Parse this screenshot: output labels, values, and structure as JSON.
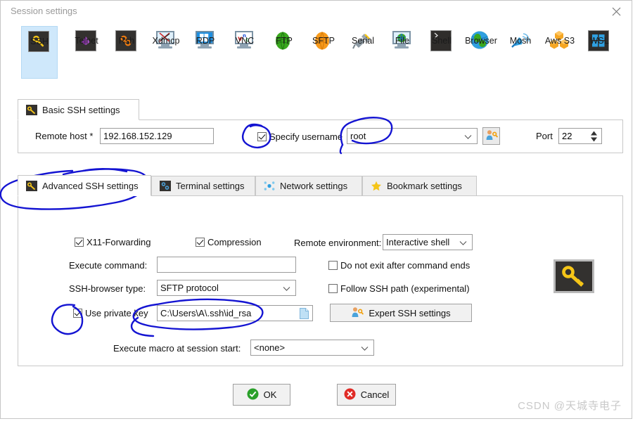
{
  "window": {
    "title": "Session settings",
    "close_icon": "close-icon"
  },
  "session_types": [
    {
      "label": "SSH",
      "icon": "ssh-icon",
      "selected": true
    },
    {
      "label": "Telnet",
      "icon": "telnet-icon",
      "selected": false
    },
    {
      "label": "Rsh",
      "icon": "rsh-icon",
      "selected": false
    },
    {
      "label": "Xdmcp",
      "icon": "xdmcp-icon",
      "selected": false
    },
    {
      "label": "RDP",
      "icon": "rdp-icon",
      "selected": false
    },
    {
      "label": "VNC",
      "icon": "vnc-icon",
      "selected": false
    },
    {
      "label": "FTP",
      "icon": "ftp-icon",
      "selected": false
    },
    {
      "label": "SFTP",
      "icon": "sftp-icon",
      "selected": false
    },
    {
      "label": "Serial",
      "icon": "serial-icon",
      "selected": false
    },
    {
      "label": "File",
      "icon": "file-icon",
      "selected": false
    },
    {
      "label": "Shell",
      "icon": "shell-icon",
      "selected": false
    },
    {
      "label": "Browser",
      "icon": "browser-icon",
      "selected": false
    },
    {
      "label": "Mosh",
      "icon": "mosh-icon",
      "selected": false
    },
    {
      "label": "Aws S3",
      "icon": "aws-s3-icon",
      "selected": false
    },
    {
      "label": "WSL",
      "icon": "wsl-icon",
      "selected": false
    }
  ],
  "basic": {
    "tab_label": "Basic SSH settings",
    "remote_host_label": "Remote host *",
    "remote_host_value": "192.168.152.129",
    "specify_username_label": "Specify username",
    "specify_username_checked": true,
    "username_value": "root",
    "credential_button_icon": "user-key-icon",
    "port_label": "Port",
    "port_value": "22"
  },
  "advanced_tabs": [
    {
      "label": "Advanced SSH settings",
      "icon": "key-tab-icon",
      "active": true
    },
    {
      "label": "Terminal settings",
      "icon": "terminal-tab-icon",
      "active": false
    },
    {
      "label": "Network settings",
      "icon": "network-tab-icon",
      "active": false
    },
    {
      "label": "Bookmark settings",
      "icon": "star-tab-icon",
      "active": false
    }
  ],
  "advanced": {
    "x11_label": "X11-Forwarding",
    "x11_checked": true,
    "compression_label": "Compression",
    "compression_checked": true,
    "remote_env_label": "Remote environment:",
    "remote_env_value": "Interactive shell",
    "execute_command_label": "Execute command:",
    "execute_command_value": "",
    "do_not_exit_label": "Do not exit after command ends",
    "do_not_exit_checked": false,
    "ssh_browser_label": "SSH-browser type:",
    "ssh_browser_value": "SFTP protocol",
    "follow_ssh_path_label": "Follow SSH path (experimental)",
    "follow_ssh_path_checked": false,
    "use_private_key_label": "Use private key",
    "use_private_key_checked": true,
    "private_key_value": "C:\\Users\\A\\.ssh\\id_rsa",
    "browse_icon": "file-browse-icon",
    "expert_button_label": "Expert SSH settings",
    "expert_button_icon": "user-key-icon",
    "macro_label": "Execute macro at session start:",
    "macro_value": "<none>",
    "side_icon": "key-icon"
  },
  "footer": {
    "ok_label": "OK",
    "cancel_label": "Cancel",
    "ok_icon": "check-circle-icon",
    "cancel_icon": "cancel-circle-icon"
  },
  "watermark": {
    "text": "CSDN @天城寺电子"
  },
  "colors": {
    "selection": "#cfe8fb",
    "ink": "#1414d2",
    "ok_green": "#2aa02a",
    "cancel_red": "#e02b26",
    "key_yellow": "#f5c518"
  }
}
